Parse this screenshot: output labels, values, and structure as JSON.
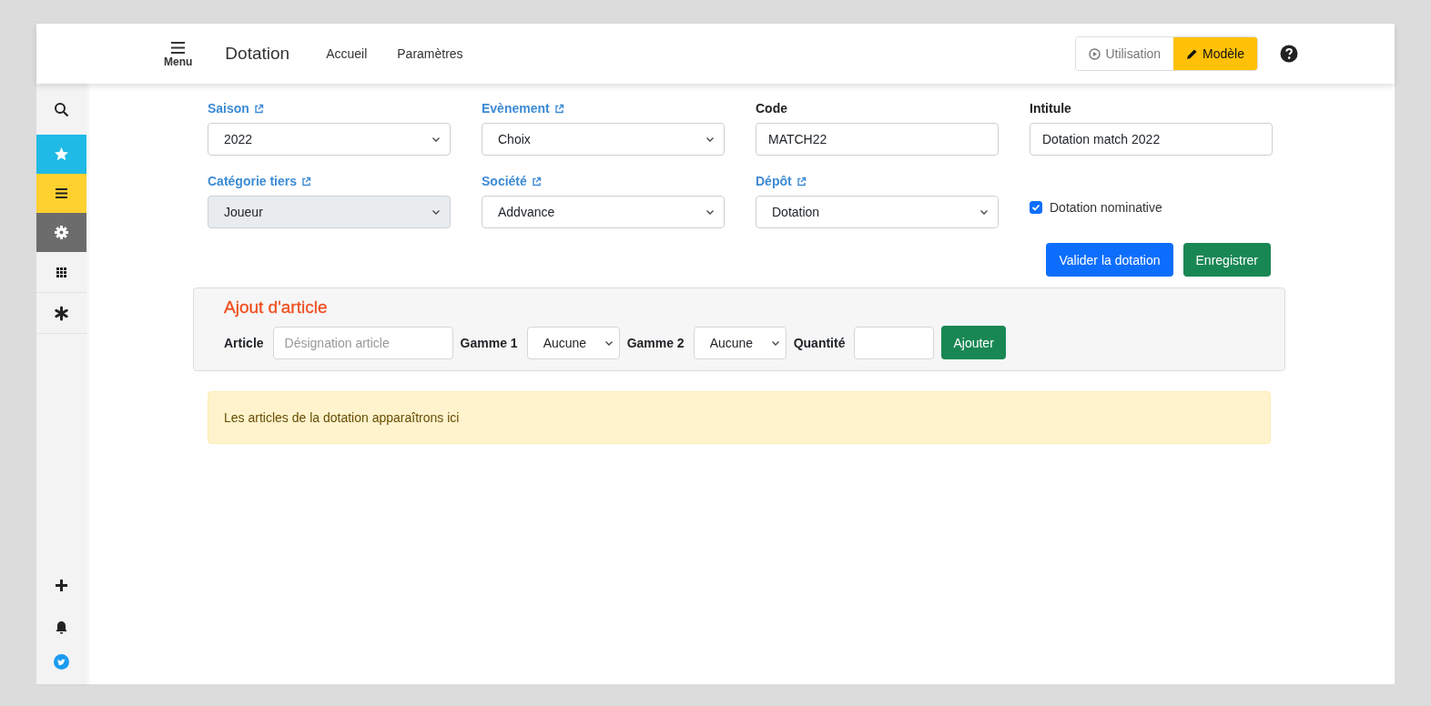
{
  "header": {
    "menu_label": "Menu",
    "title": "Dotation",
    "nav": [
      "Accueil",
      "Paramètres"
    ],
    "modes": [
      {
        "label": "Utilisation",
        "selected": false
      },
      {
        "label": "Modèle",
        "selected": true
      }
    ]
  },
  "sidebar": {
    "highlighted": [
      {
        "color": "#1fbae6"
      },
      {
        "color": "#ffd12f"
      },
      {
        "color": "#6c6c6c"
      }
    ]
  },
  "form": {
    "fields": [
      {
        "kind": "select",
        "label": "Saison",
        "linked": true,
        "value": "2022",
        "disabled": false
      },
      {
        "kind": "select",
        "label": "Evènement",
        "linked": true,
        "value": "Choix",
        "disabled": false
      },
      {
        "kind": "text",
        "label": "Code",
        "linked": false,
        "value": "MATCH22"
      },
      {
        "kind": "text",
        "label": "Intitule",
        "linked": false,
        "value": "Dotation match 2022"
      },
      {
        "kind": "select",
        "label": "Catégorie tiers",
        "linked": true,
        "value": "Joueur",
        "disabled": true
      },
      {
        "kind": "select",
        "label": "Société",
        "linked": true,
        "value": "Addvance",
        "disabled": false
      },
      {
        "kind": "select",
        "label": "Dépôt",
        "linked": true,
        "value": "Dotation",
        "disabled": false
      },
      {
        "kind": "checkbox",
        "label": "Dotation nominative",
        "checked": true
      }
    ],
    "buttons": [
      {
        "label": "Valider la dotation",
        "kind": "primary"
      },
      {
        "label": "Enregistrer",
        "kind": "success"
      }
    ]
  },
  "add_article": {
    "title": "Ajout d'article",
    "controls": [
      {
        "kind": "label",
        "text": "Article"
      },
      {
        "kind": "text",
        "placeholder": "Désignation article"
      },
      {
        "kind": "label",
        "text": "Gamme 1"
      },
      {
        "kind": "select",
        "value": "Aucune"
      },
      {
        "kind": "label",
        "text": "Gamme 2"
      },
      {
        "kind": "select",
        "value": "Aucune"
      },
      {
        "kind": "label",
        "text": "Quantité"
      },
      {
        "kind": "number"
      },
      {
        "kind": "button",
        "text": "Ajouter"
      }
    ]
  },
  "alert": "Les articles de la dotation apparaîtrons ici"
}
